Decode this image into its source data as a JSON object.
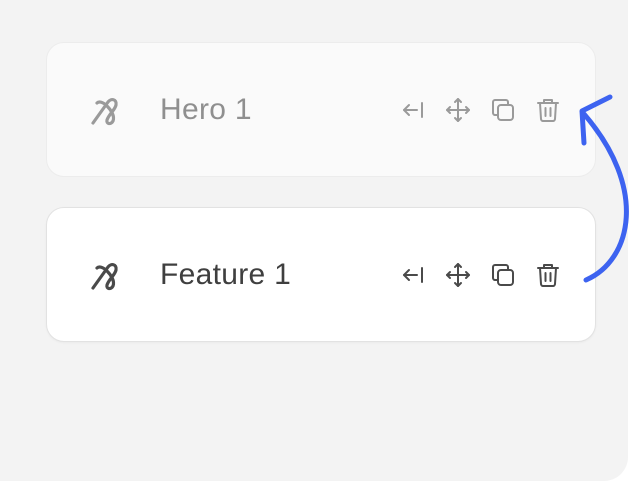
{
  "cards": [
    {
      "title": "Hero 1",
      "icon": "component-icon",
      "actions": [
        "move-to-start-icon",
        "drag-move-icon",
        "duplicate-icon",
        "delete-icon"
      ]
    },
    {
      "title": "Feature 1",
      "icon": "component-icon",
      "actions": [
        "move-to-start-icon",
        "drag-move-icon",
        "duplicate-icon",
        "delete-icon"
      ]
    }
  ],
  "colors": {
    "panel_bg": "#f3f3f3",
    "arrow": "#3d63f0",
    "muted_text": "#8f8f8f",
    "active_text": "#3f3f3f"
  }
}
